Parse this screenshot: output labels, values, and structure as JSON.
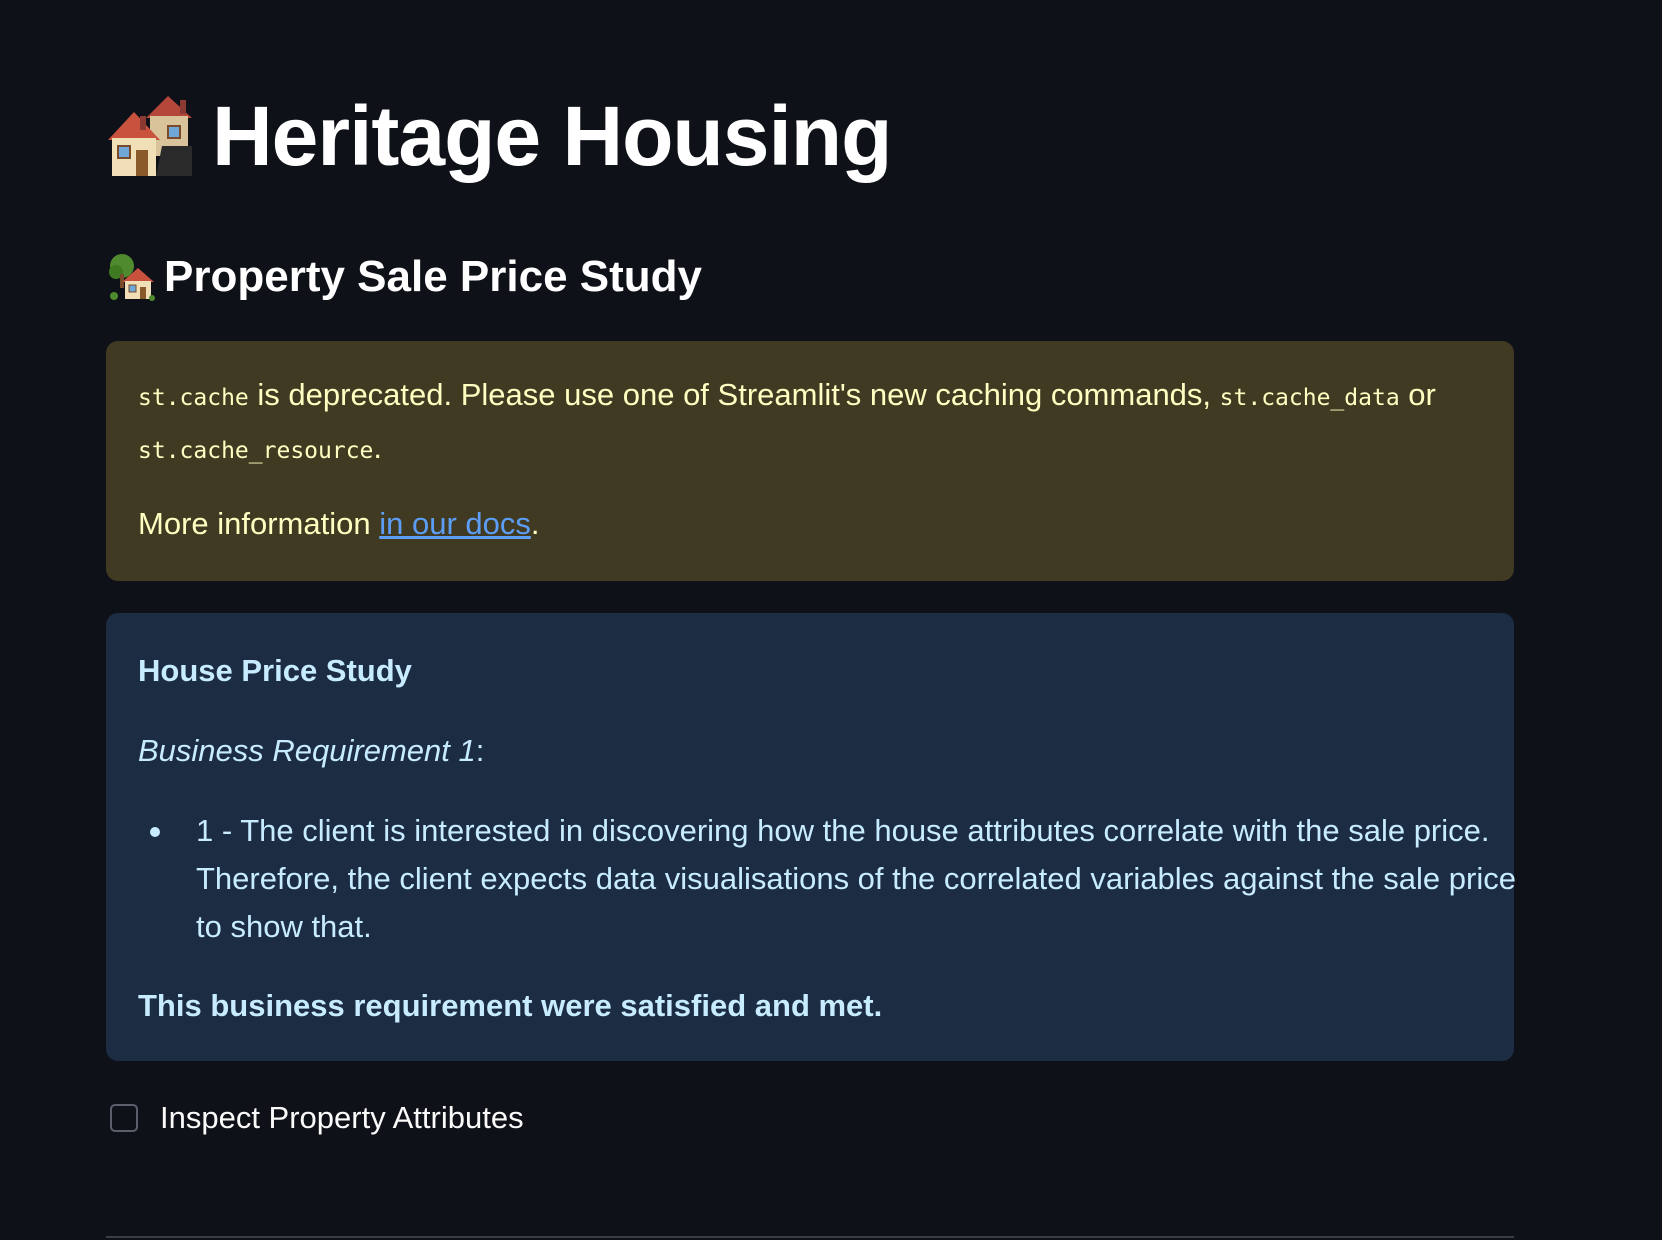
{
  "header": {
    "title": "Heritage Housing",
    "title_icon": "houses-icon"
  },
  "page": {
    "subtitle": "Property Sale Price Study",
    "subtitle_icon": "house-with-garden-icon"
  },
  "warning": {
    "code_cache": "st.cache",
    "text_1": " is deprecated. Please use one of Streamlit's new caching commands, ",
    "code_cache_data": "st.cache_data",
    "text_or": " or",
    "code_cache_resource": "st.cache_resource",
    "text_period": ".",
    "more_info_text": "More information ",
    "docs_link_label": "in our docs",
    "more_info_end": ".",
    "background_color": "#413a22",
    "text_color": "#ffffc2",
    "link_color": "#5c9ef5"
  },
  "info": {
    "heading": "House Price Study",
    "requirement_label": "Business Requirement 1",
    "requirement_colon": ":",
    "bullet_line_1": "1 - The client is interested in discovering how the house attributes correlate with the sale price.",
    "bullet_line_2": "Therefore, the client expects data visualisations of the correlated variables against the sale price",
    "bullet_line_3": "to show that.",
    "footer": "This business requirement were satisfied and met.",
    "background_color": "#1c2c43",
    "text_color": "#c7ebff"
  },
  "checkbox": {
    "label": "Inspect Property Attributes",
    "checked": false
  },
  "theme": {
    "background": "#0e1117",
    "text": "#fafafa"
  }
}
